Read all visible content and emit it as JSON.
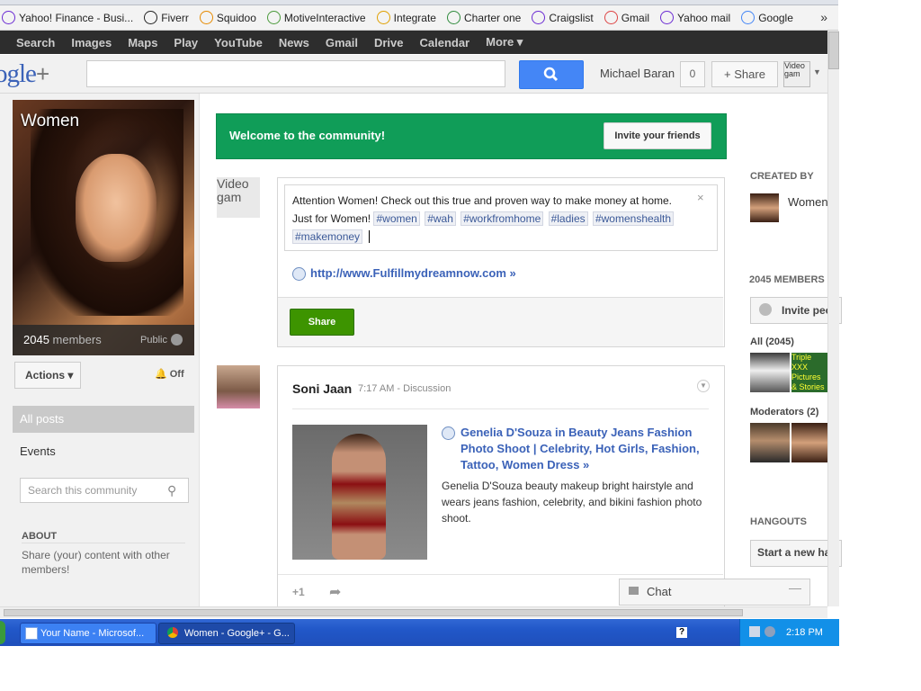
{
  "bookmarks": [
    {
      "label": "Yahoo! Finance - Busi...",
      "icon": "yahoo-icon",
      "color": "#6b2bd3"
    },
    {
      "label": "Fiverr",
      "icon": "fiverr-icon",
      "color": "#222222"
    },
    {
      "label": "Squidoo",
      "icon": "squidoo-icon",
      "color": "#e68a00"
    },
    {
      "label": "MotiveInteractive",
      "icon": "motive-icon",
      "color": "#4a9a3a"
    },
    {
      "label": "Integrate",
      "icon": "integrate-icon",
      "color": "#e0a000"
    },
    {
      "label": "Charter one",
      "icon": "charter-icon",
      "color": "#2d8a3a"
    },
    {
      "label": "Craigslist",
      "icon": "peace-icon",
      "color": "#6b2bd3"
    },
    {
      "label": "Gmail",
      "icon": "gmail-icon",
      "color": "#d44"
    },
    {
      "label": "Yahoo mail",
      "icon": "yahoo-icon",
      "color": "#6b2bd3"
    },
    {
      "label": "Google",
      "icon": "google-icon",
      "color": "#4486f6"
    }
  ],
  "bookmarks_overflow": "»",
  "gbar": [
    "Search",
    "Images",
    "Maps",
    "Play",
    "YouTube",
    "News",
    "Gmail",
    "Drive",
    "Calendar",
    "More ▾"
  ],
  "header": {
    "logo": "ogle",
    "logo_plus": "+",
    "user_name": "Michael Baran",
    "notifications": "0",
    "share_label": "+ Share",
    "avatar_text": "Video gam"
  },
  "community": {
    "title": "Women",
    "members_count": "2045",
    "members_word": "members",
    "visibility": "Public",
    "actions_label": "Actions ▾",
    "notifications_label": "🔔 Off",
    "nav_all_posts": "All posts",
    "nav_events": "Events",
    "search_placeholder": "Search this community",
    "about_heading": "ABOUT",
    "about_text": "Share (your) content with other members!"
  },
  "welcome": {
    "text": "Welcome to the community!",
    "invite_label": "Invite your friends"
  },
  "composer": {
    "avatar_text": "Video gam",
    "text": "Attention Women! Check out this true and proven way to make money at home. Just for Women!",
    "tags": [
      "#women",
      "#wah",
      "#workfromhome",
      "#ladies",
      "#womenshealth",
      "#makemoney"
    ],
    "close": "×",
    "link": "http://www.Fulfillmydreamnow.com »",
    "share_label": "Share"
  },
  "post": {
    "author": "Soni Jaan",
    "time": "7:17 AM",
    "separator": "-",
    "category": "Discussion",
    "link_title": "Genelia D'Souza in Beauty Jeans Fashion Photo Shoot | Celebrity, Hot Girls, Fashion, Tattoo, Women Dress »",
    "description": "Genelia D'Souza beauty makeup bright hairstyle and wears jeans fashion, celebrity, and bikini fashion photo shoot.",
    "plusone": "+1"
  },
  "chat": {
    "label": "Chat",
    "minimize": "—"
  },
  "sidebar": {
    "created_by": "CREATED BY",
    "creator": "Women",
    "members_heading": "2045 MEMBERS",
    "invite_label": "Invite peo",
    "all_label": "All (2045)",
    "thumb_text": "Triple XXX Pictures & Stories",
    "moderators_label": "Moderators (2)",
    "hangouts_heading": "HANGOUTS",
    "hangout_label": "Start a new ha"
  },
  "taskbar": {
    "task1": "Your Name - Microsof...",
    "task2": "Women - Google+ - G...",
    "clock": "2:18 PM"
  }
}
